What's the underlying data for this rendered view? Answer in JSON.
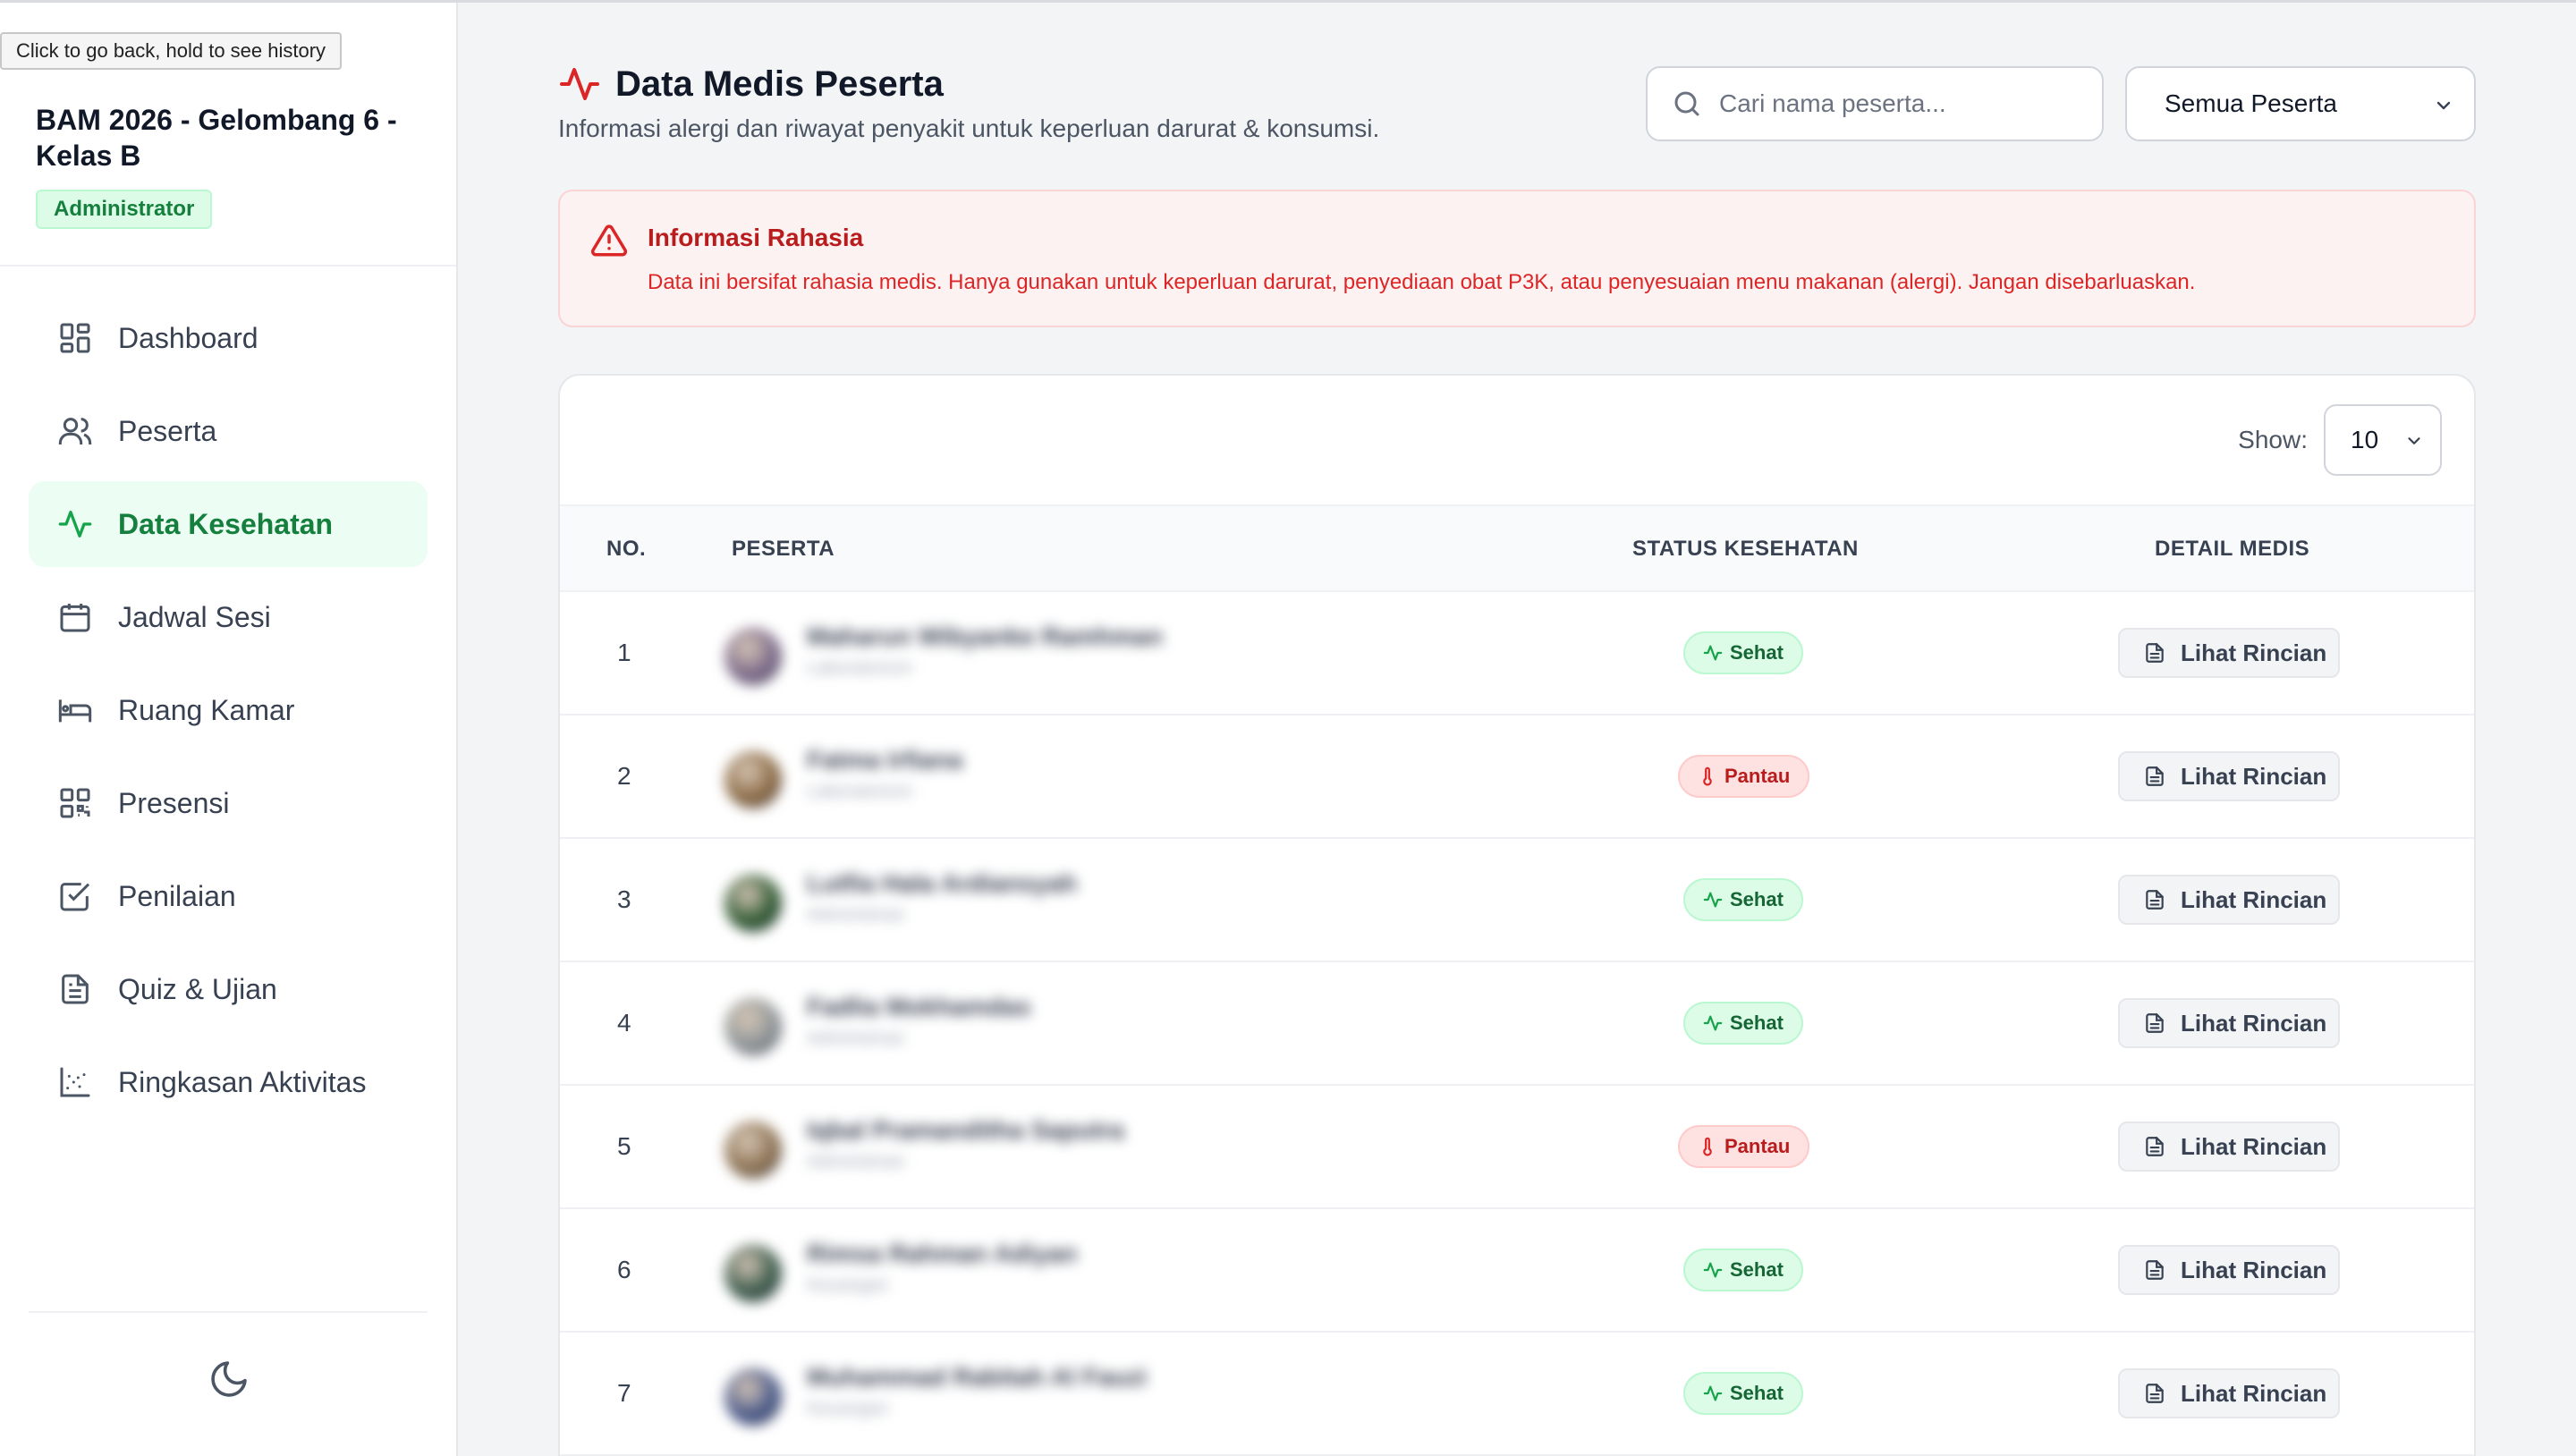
{
  "browser": {
    "tooltip": "Click to go back, hold to see history"
  },
  "sidebar": {
    "brand": "BAM 2026 - Gelombang 6 - Kelas B",
    "role": "Administrator",
    "items": [
      {
        "label": "Dashboard",
        "icon": "dashboard-icon",
        "active": false
      },
      {
        "label": "Peserta",
        "icon": "users-icon",
        "active": false
      },
      {
        "label": "Data Kesehatan",
        "icon": "activity-icon",
        "active": true
      },
      {
        "label": "Jadwal Sesi",
        "icon": "calendar-icon",
        "active": false
      },
      {
        "label": "Ruang Kamar",
        "icon": "bed-icon",
        "active": false
      },
      {
        "label": "Presensi",
        "icon": "qr-code-icon",
        "active": false
      },
      {
        "label": "Penilaian",
        "icon": "check-square-icon",
        "active": false
      },
      {
        "label": "Quiz & Ujian",
        "icon": "file-text-icon",
        "active": false
      },
      {
        "label": "Ringkasan Aktivitas",
        "icon": "scatter-chart-icon",
        "active": false
      }
    ],
    "theme_toggle_icon": "moon-icon"
  },
  "header": {
    "title": "Data Medis Peserta",
    "subtitle": "Informasi alergi dan riwayat penyakit untuk keperluan darurat & konsumsi.",
    "search_placeholder": "Cari nama peserta...",
    "filter_value": "Semua Peserta"
  },
  "alert": {
    "title": "Informasi Rahasia",
    "text": "Data ini bersifat rahasia medis. Hanya gunakan untuk keperluan darurat, penyediaan obat P3K, atau penyesuaian menu makanan (alergi). Jangan disebarluaskan."
  },
  "table": {
    "show_label": "Show:",
    "show_value": "10",
    "columns": {
      "no": "NO.",
      "peserta": "PESERTA",
      "status": "STATUS KESEHATAN",
      "detail": "DETAIL MEDIS"
    },
    "detail_label": "Lihat Rincian",
    "rows": [
      {
        "no": "1",
        "name": "Maharun Wibyanke Ramhman",
        "sub": "Laboratorium",
        "status": "Sehat",
        "status_type": "sehat",
        "avatar_color": "#7c6a8a"
      },
      {
        "no": "2",
        "name": "Fatma Irfiana",
        "sub": "Laboratorium",
        "status": "Pantau",
        "status_type": "pantau",
        "avatar_color": "#8b6a44"
      },
      {
        "no": "3",
        "name": "Lutfia Hala Ardiansyah",
        "sub": "Administrasi",
        "status": "Sehat",
        "status_type": "sehat",
        "avatar_color": "#2f5a32"
      },
      {
        "no": "4",
        "name": "Fadlia Mokhamdas",
        "sub": "Administrasi",
        "status": "Sehat",
        "status_type": "sehat",
        "avatar_color": "#8f9698"
      },
      {
        "no": "5",
        "name": "Iqbal Pramanditha Saputra",
        "sub": "Administrasi",
        "status": "Pantau",
        "status_type": "pantau",
        "avatar_color": "#8c7252"
      },
      {
        "no": "6",
        "name": "Rimsa Rahman Adiyan",
        "sub": "Keuangan",
        "status": "Sehat",
        "status_type": "sehat",
        "avatar_color": "#3a5a4a"
      },
      {
        "no": "7",
        "name": "Muhammad Rabitah Al Fauzi",
        "sub": "Keuangan",
        "status": "Sehat",
        "status_type": "sehat",
        "avatar_color": "#4a5a8a"
      }
    ]
  }
}
